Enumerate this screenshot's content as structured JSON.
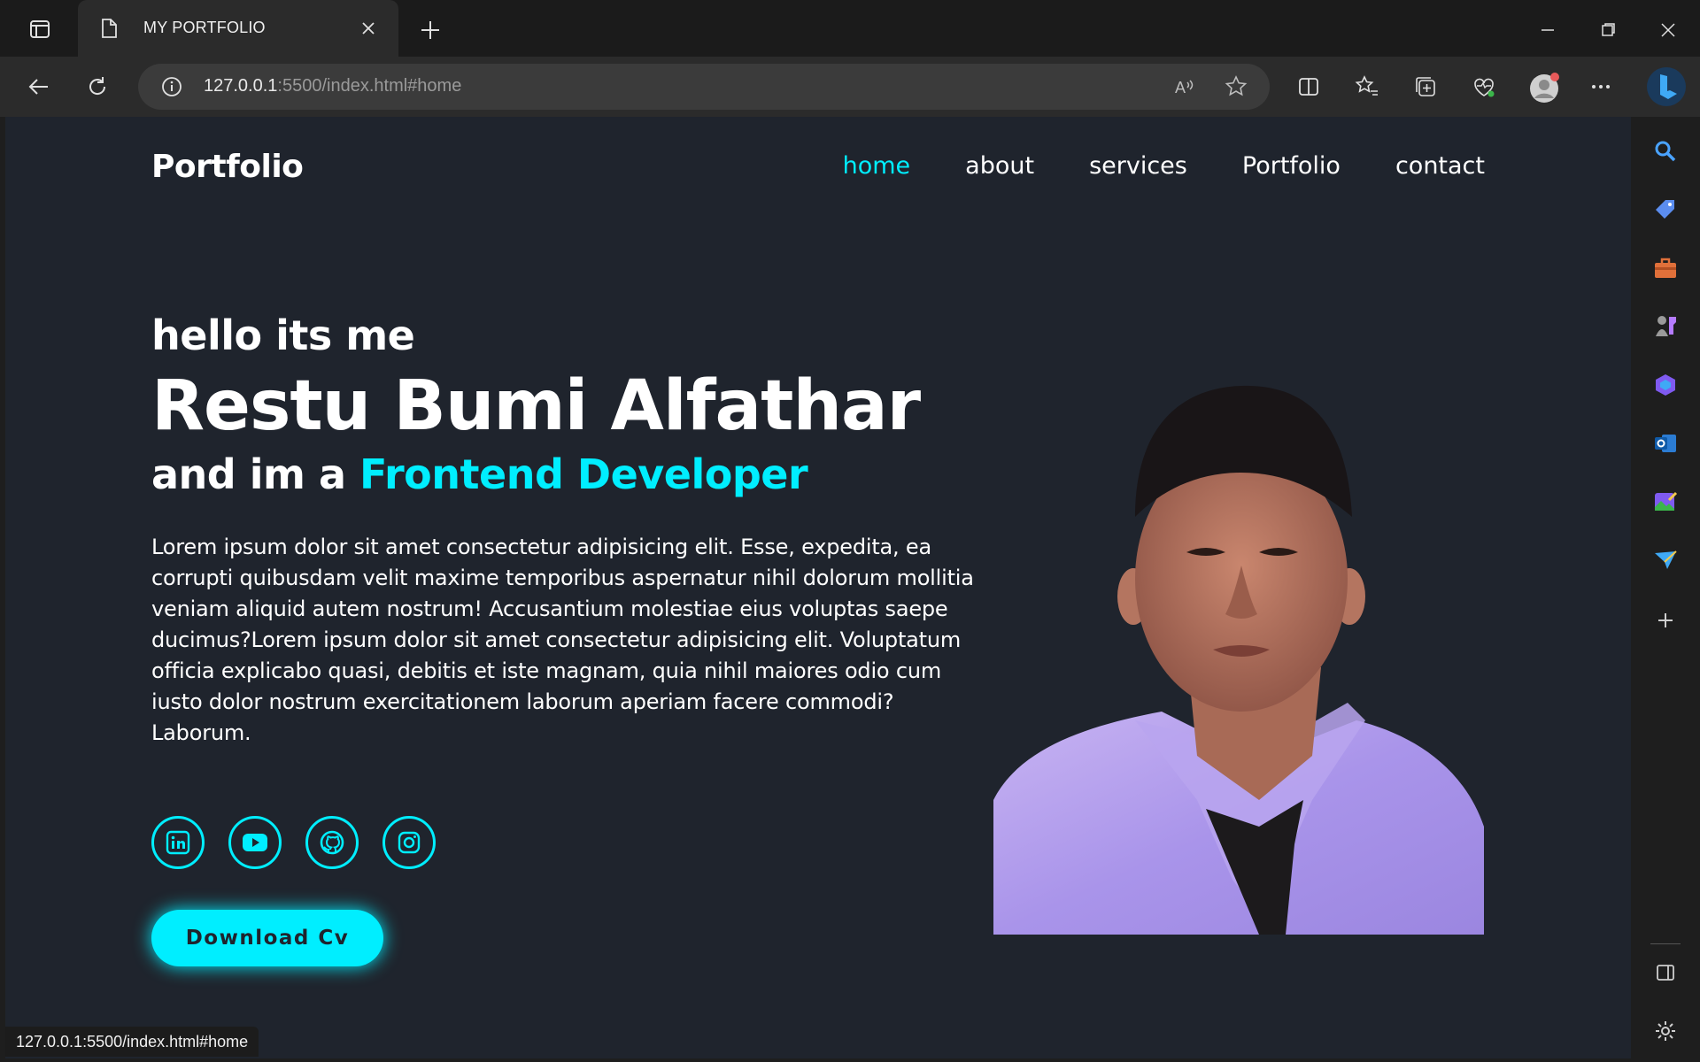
{
  "browser": {
    "tab_title": "MY PORTFOLIO",
    "url_host": "127.0.0.1",
    "url_rest": ":5500/index.html#home",
    "status_url": "127.0.0.1:5500/index.html#home"
  },
  "site": {
    "logo": "Portfolio",
    "nav": [
      {
        "label": "home",
        "active": true
      },
      {
        "label": "about"
      },
      {
        "label": "services"
      },
      {
        "label": "Portfolio"
      },
      {
        "label": "contact"
      }
    ]
  },
  "hero": {
    "greeting": "hello its me",
    "name": "Restu Bumi Alfathar",
    "role_prefix": "and im a ",
    "role_highlight": "Frontend Developer",
    "description": "Lorem ipsum dolor sit amet consectetur adipisicing elit. Esse, expedita, ea corrupti quibusdam velit maxime temporibus aspernatur nihil dolorum mollitia veniam aliquid autem nostrum! Accusantium molestiae eius voluptas saepe ducimus?Lorem ipsum dolor sit amet consectetur adipisicing elit. Voluptatum officia explicabo quasi, debitis et iste magnam, quia nihil maiores odio cum iusto dolor nostrum exercitationem laborum aperiam facere commodi? Laborum.",
    "socials": [
      "linkedin-icon",
      "youtube-icon",
      "github-icon",
      "instagram-icon"
    ],
    "cv_button": "Download Cv"
  },
  "colors": {
    "accent": "#00eeff",
    "background": "#1f242d",
    "text": "#ffffff"
  }
}
